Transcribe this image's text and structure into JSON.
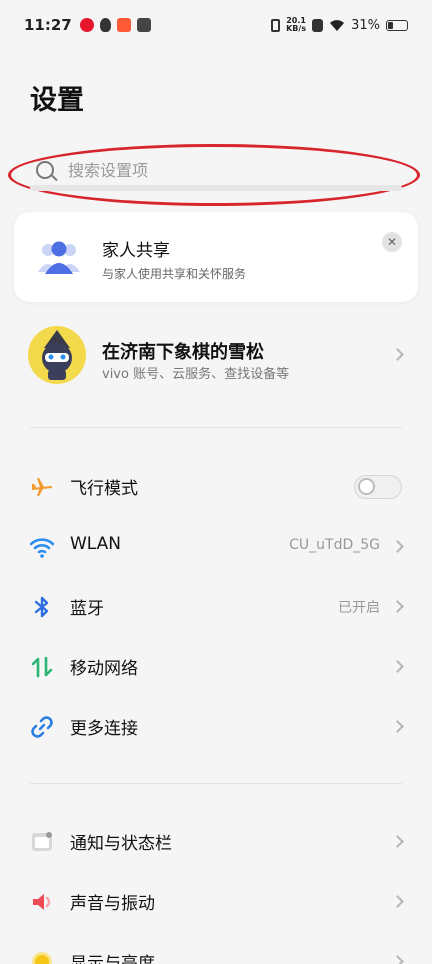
{
  "status_bar": {
    "time": "11:27",
    "net_speed_value": "20.1",
    "net_speed_unit": "KB/s",
    "battery": "31%",
    "battery_level": 0.31
  },
  "page": {
    "title": "设置"
  },
  "search": {
    "placeholder": "搜索设置项"
  },
  "family_card": {
    "title": "家人共享",
    "subtitle": "与家人使用共享和关怀服务"
  },
  "account": {
    "name": "在济南下象棋的雪松",
    "subtitle": "vivo 账号、云服务、查找设备等"
  },
  "connectivity": [
    {
      "label": "飞行模式",
      "icon": "airplane-icon",
      "value": "",
      "toggle": false
    },
    {
      "label": "WLAN",
      "icon": "wifi-icon",
      "value": "CU_uTdD_5G"
    },
    {
      "label": "蓝牙",
      "icon": "bluetooth-icon",
      "value": "已开启"
    },
    {
      "label": "移动网络",
      "icon": "mobile-network-icon",
      "value": ""
    },
    {
      "label": "更多连接",
      "icon": "link-icon",
      "value": ""
    }
  ],
  "system": [
    {
      "label": "通知与状态栏",
      "icon": "notification-icon"
    },
    {
      "label": "声音与振动",
      "icon": "sound-icon"
    },
    {
      "label": "显示与亮度",
      "icon": "brightness-icon"
    }
  ],
  "colors": {
    "highlight": "#d7252c",
    "airplane": "#f39a2e",
    "wifi": "#2c8df0",
    "bluetooth": "#2e6fe0",
    "mobile": "#2bb673",
    "link": "#2a7de1",
    "sound": "#ef4b57",
    "brightness": "#f5c518"
  }
}
